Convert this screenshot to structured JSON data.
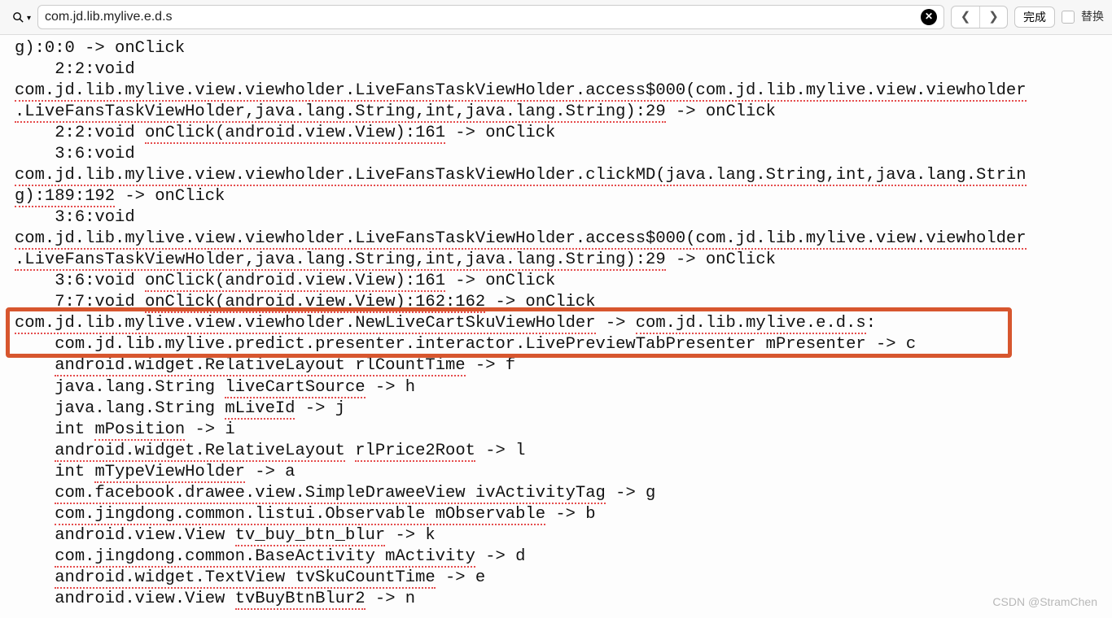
{
  "findbar": {
    "query": "com.jd.lib.mylive.e.d.s",
    "done": "完成",
    "replace": "替换"
  },
  "code": {
    "lines": [
      {
        "pre": "",
        "u": "",
        "post": "g):0:0 -> onClick"
      },
      {
        "pre": "    2:2:void",
        "u": "",
        "post": ""
      },
      {
        "pre": "",
        "u": "com.jd.lib.mylive.view.viewholder.LiveFansTaskViewHolder.access$000(com.jd.lib.mylive.view.viewholder",
        "post": ""
      },
      {
        "pre": "",
        "u": ".LiveFansTaskViewHolder,java.lang.String,int,java.lang.String):29",
        "post": " -> onClick"
      },
      {
        "pre": "    2:2:void ",
        "u": "onClick(android.view.View):161",
        "post": " -> onClick"
      },
      {
        "pre": "    3:6:void",
        "u": "",
        "post": ""
      },
      {
        "pre": "",
        "u": "com.jd.lib.mylive.view.viewholder.LiveFansTaskViewHolder.clickMD(java.lang.String,int,java.lang.Strin",
        "post": ""
      },
      {
        "pre": "",
        "u": "g):189:192",
        "post": " -> onClick"
      },
      {
        "pre": "    3:6:void",
        "u": "",
        "post": ""
      },
      {
        "pre": "",
        "u": "com.jd.lib.mylive.view.viewholder.LiveFansTaskViewHolder.access$000(com.jd.lib.mylive.view.viewholder",
        "post": ""
      },
      {
        "pre": "",
        "u": ".LiveFansTaskViewHolder,java.lang.String,int,java.lang.String):29",
        "post": " -> onClick"
      },
      {
        "pre": "    3:6:void ",
        "u": "onClick(android.view.View):161",
        "post": " -> onClick"
      },
      {
        "pre": "    7:7:void ",
        "u": "onClick(android.view.View):162:162",
        "post": " -> onClick"
      },
      {
        "pre": "",
        "u": "com.jd.lib.mylive.view.viewholder.NewLiveCartSkuViewHolder",
        "post": " -> ",
        "u2": "com.jd.lib.mylive.e.d.s",
        "post2": ":"
      },
      {
        "pre": "    ",
        "u": "com.jd.lib.mylive.predict.presenter.interactor.LivePreviewTabPresenter mPresenter",
        "post": " -> c"
      },
      {
        "pre": "    ",
        "u": "android.widget.RelativeLayout rlCountTime",
        "post": " -> f"
      },
      {
        "pre": "    java.lang.String ",
        "u": "liveCartSource",
        "post": " -> h"
      },
      {
        "pre": "    java.lang.String ",
        "u": "mLiveId",
        "post": " -> j"
      },
      {
        "pre": "    int ",
        "u": "mPosition",
        "post": " -> i"
      },
      {
        "pre": "    ",
        "u": "android.widget.RelativeLayout",
        "post": " ",
        "u2": "rlPrice2Root",
        "post2": " -> l"
      },
      {
        "pre": "    int ",
        "u": "mTypeViewHolder",
        "post": " -> a"
      },
      {
        "pre": "    ",
        "u": "com.facebook.drawee.view.SimpleDraweeView ivActivityTag",
        "post": " -> g"
      },
      {
        "pre": "    ",
        "u": "com.jingdong.common.listui.Observable mObservable",
        "post": " -> b"
      },
      {
        "pre": "    android.view.View ",
        "u": "tv_buy_btn_blur",
        "post": " -> k"
      },
      {
        "pre": "    ",
        "u": "com.jingdong.common.BaseActivity mActivity",
        "post": " -> d"
      },
      {
        "pre": "    ",
        "u": "android.widget.TextView tvSkuCountTime",
        "post": " -> e"
      },
      {
        "pre": "    android.view.View ",
        "u": "tvBuyBtnBlur2",
        "post": " -> n"
      }
    ]
  },
  "watermark": "CSDN @StramChen"
}
